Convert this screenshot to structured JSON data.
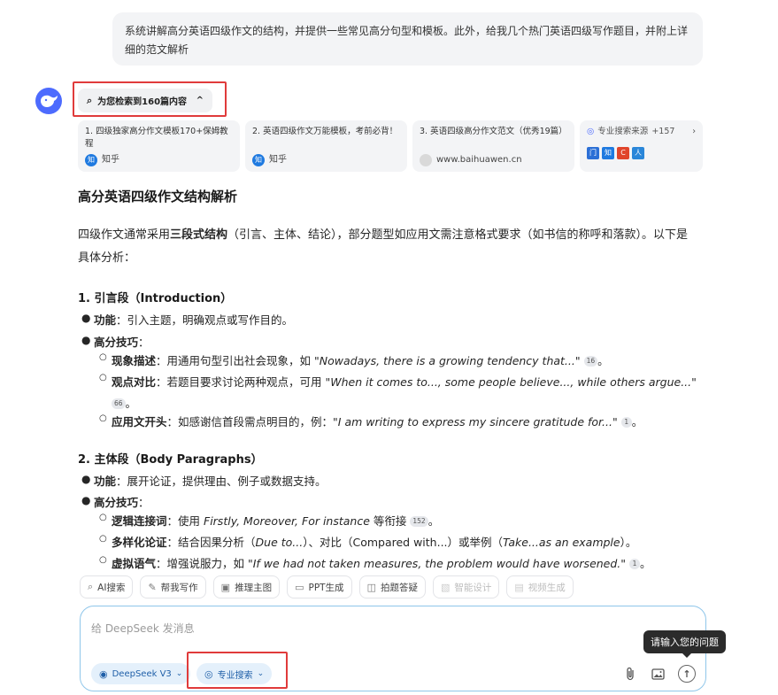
{
  "user_message": "系统讲解高分英语四级作文的结构，并提供一些常见高分句型和模板。此外，给我几个热门英语四级写作题目，并附上详细的范文解析",
  "search_toggle": {
    "label": "为您检索到160篇内容",
    "caret": "^"
  },
  "sources": [
    {
      "title": "1. 四级独家高分作文模板170+保姆教程",
      "site": "知乎",
      "site_badge": "知"
    },
    {
      "title": "2. 英语四级作文万能模板，考前必背！",
      "site": "知乎",
      "site_badge": "知"
    },
    {
      "title": "3. 英语四级高分作文范文（优秀19篇）",
      "site": "www.baihuawen.cn"
    }
  ],
  "sources_more": {
    "label": "专业搜索来源",
    "count": "+157",
    "icons": [
      {
        "text": "门",
        "color": "#2b6fd6"
      },
      {
        "text": "知",
        "color": "#1f7ae0"
      },
      {
        "text": "C",
        "color": "#e0452b"
      },
      {
        "text": "人",
        "color": "#2a86d9"
      }
    ]
  },
  "answer": {
    "heading": "高分英语四级作文结构解析",
    "intro_pre": "四级作文通常采用",
    "intro_bold": "三段式结构",
    "intro_post": "（引言、主体、结论），部分题型如应用文需注意格式要求（如书信的称呼和落款）。以下是具体分析：",
    "sec1": {
      "heading": "1. 引言段（Introduction）",
      "func_label": "功能",
      "func_text": "：引入主题，明确观点或写作目的。",
      "tips_label": "高分技巧",
      "tips_colon": "：",
      "tips": [
        {
          "label": "现象描述",
          "pre": "：用通用句型引出社会现象，如 ",
          "quote": "\"Nowadays, there is a growing tendency that...\"",
          "cite": "16",
          "post": "。"
        },
        {
          "label": "观点对比",
          "pre": "：若题目要求讨论两种观点，可用 ",
          "quote": "\"When it comes to..., some people believe..., while others argue...\"",
          "cite": "66",
          "post": "。"
        },
        {
          "label": "应用文开头",
          "pre": "：如感谢信首段需点明目的，例：",
          "quote": "\"I am writing to express my sincere gratitude for...\"",
          "cite": "1",
          "post": "。"
        }
      ]
    },
    "sec2": {
      "heading": "2. 主体段（Body Paragraphs）",
      "func_label": "功能",
      "func_text": "：展开论证，提供理由、例子或数据支持。",
      "tips_label": "高分技巧",
      "tips_colon": "：",
      "tips": [
        {
          "label": "逻辑连接词",
          "pre": "：使用 ",
          "quote": "Firstly, Moreover, For instance",
          "mid": " 等衔接",
          "cite": "152",
          "post": "。"
        },
        {
          "label": "多样化论证",
          "pre": "：结合因果分析（",
          "quote": "Due to...",
          "mid": "）、对比（Compared with...）或举例（",
          "quote2": "Take...as an example",
          "post": "）。"
        },
        {
          "label": "虚拟语气",
          "pre": "：增强说服力，如 ",
          "quote": "\"If we had not taken measures, the problem would have worsened.\"",
          "cite": "1",
          "post": "。"
        }
      ]
    }
  },
  "toolbar": [
    {
      "label": "AI搜索",
      "icon": "search-icon",
      "glyph": "⌕",
      "enabled": true
    },
    {
      "label": "帮我写作",
      "icon": "pen-icon",
      "glyph": "✎",
      "enabled": true
    },
    {
      "label": "推理主图",
      "icon": "image-icon",
      "glyph": "▣",
      "enabled": true
    },
    {
      "label": "PPT生成",
      "icon": "ppt-icon",
      "glyph": "▭",
      "enabled": true
    },
    {
      "label": "拍题答疑",
      "icon": "camera-icon",
      "glyph": "◫",
      "enabled": true
    },
    {
      "label": "智能设计",
      "icon": "design-icon",
      "glyph": "▧",
      "enabled": false
    },
    {
      "label": "视频生成",
      "icon": "video-icon",
      "glyph": "▤",
      "enabled": false
    }
  ],
  "composer": {
    "placeholder": "给 DeepSeek 发消息",
    "model_label": "DeepSeek V3",
    "pro_search_label": "专业搜索",
    "tooltip": "请输入您的问题"
  },
  "colors": {
    "accent": "#4d6bfe",
    "highlight_box": "#e03b3b",
    "composer_border": "#8fc6ea"
  }
}
